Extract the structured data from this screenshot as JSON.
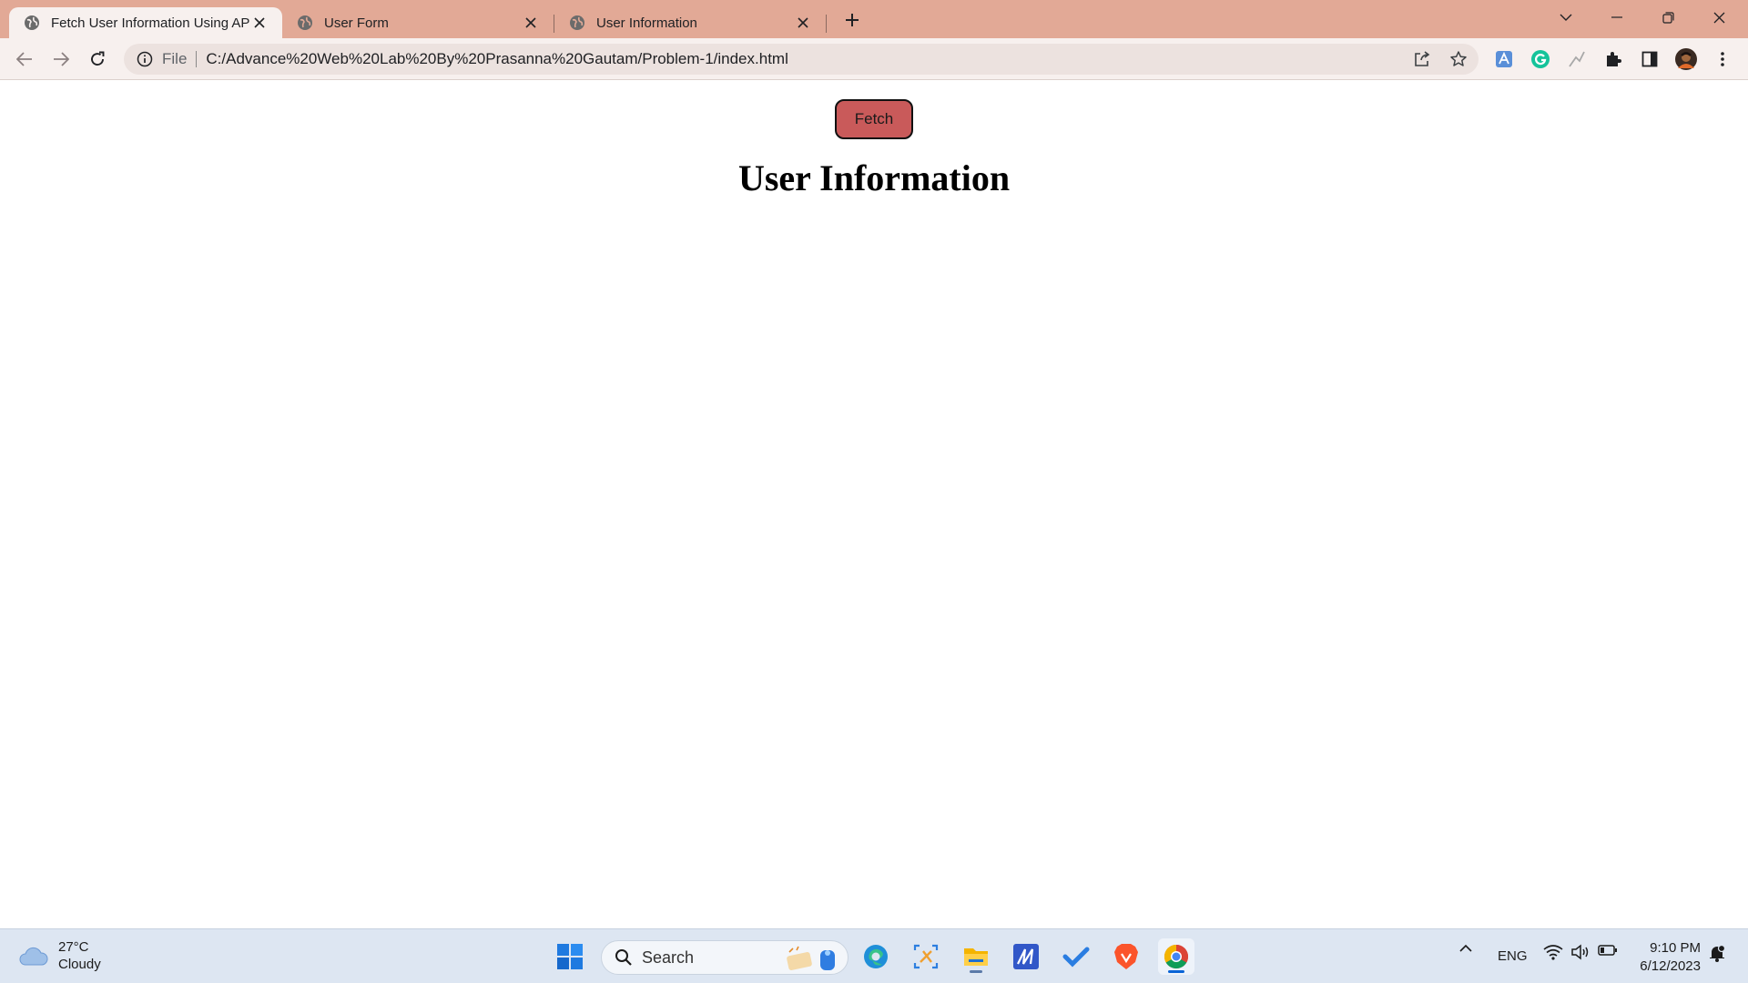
{
  "browser": {
    "tabs": [
      {
        "title": "Fetch User Information Using API",
        "active": true
      },
      {
        "title": "User Form",
        "active": false
      },
      {
        "title": "User Information",
        "active": false
      }
    ],
    "omnibox": {
      "scheme_label": "File",
      "url": "C:/Advance%20Web%20Lab%20By%20Prasanna%20Gautam/Problem-1/index.html"
    }
  },
  "page": {
    "fetch_button_label": "Fetch",
    "title": "User Information"
  },
  "taskbar": {
    "weather": {
      "temperature": "27°C",
      "condition": "Cloudy"
    },
    "search_label": "Search",
    "language": "ENG",
    "time": "9:10 PM",
    "date": "6/12/2023"
  },
  "colors": {
    "titlebar": "#e2a996",
    "toolbar": "#f7f0ee",
    "fetch_button": "#c95a5a",
    "taskbar": "#dde6f2"
  }
}
